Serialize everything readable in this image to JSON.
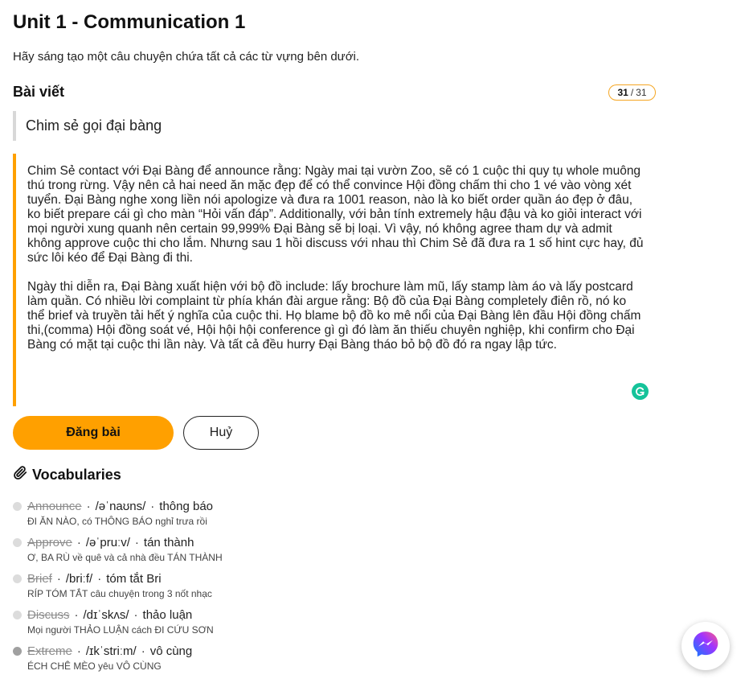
{
  "header": {
    "title": "Unit 1 - Communication 1",
    "instruction": "Hãy sáng tạo một câu chuyện chứa tất cả các từ vựng bên dưới."
  },
  "post": {
    "section_label": "Bài viết",
    "counter_current": "31",
    "counter_sep": "/",
    "counter_total": "31",
    "story_title": "Chim sẻ gọi đại bàng",
    "paragraph_1": "Chim Sẻ contact với Đại Bàng để announce rằng: Ngày mai tại vườn Zoo, sẽ có 1 cuộc thi quy tụ whole muông thú trong rừng. Vậy nên cả hai need ăn mặc đẹp để có thể convince Hội đồng chấm thi cho 1 vé vào vòng xét tuyển. Đại Bàng nghe xong liền nói apologize và đưa ra 1001 reason, nào là ko biết order quần áo đẹp ở đâu, ko biết prepare cái gì cho màn “Hỏi vấn đáp”. Additionally, với bản tính extremely hậu đậu và ko giỏi interact với mọi người xung quanh nên certain 99,999% Đại Bàng sẽ bị loại. Vì vậy, nó không agree tham dự và admit không approve cuộc thi cho lắm. Nhưng sau 1 hồi discuss với nhau thì Chim Sẻ đã đưa ra 1 số hint cực hay, đủ sức lôi kéo để Đại Bàng đi thi.",
    "paragraph_2": "Ngày thi diễn ra, Đại Bàng xuất hiện với bộ đồ include: lấy brochure làm mũ, lấy stamp làm áo và lấy postcard làm quần. Có nhiều lời complaint từ phía khán đài argue rằng: Bộ đồ của Đại Bàng completely điên rồ, nó ko thể brief và truyền tải hết ý nghĩa của cuộc thi. Họ blame bộ đồ ko mê nổi của Đại Bàng lên đầu Hội đồng chấm thi,(comma) Hội đồng soát vé, Hội hội hội conference gì gì đó làm ăn thiếu chuyên nghiệp, khi confirm cho Đại Bàng có mặt tại cuộc thi lần này. Và tất cả đều hurry Đại Bàng tháo bỏ bộ đồ đó ra ngay lập tức.",
    "submit_label": "Đăng bài",
    "cancel_label": "Huỷ"
  },
  "vocab": {
    "heading": "Vocabularies",
    "separator": "·",
    "items": [
      {
        "word": "Announce",
        "ipa": "/əˈnaʊns/",
        "meaning": "thông báo",
        "note": "ĐI ĂN NÀO, có THÔNG BÁO nghỉ trưa rồi"
      },
      {
        "word": "Approve",
        "ipa": "/əˈpruːv/",
        "meaning": "tán thành",
        "note": "Ơ, BA RÙ về quê và cả nhà đều TÁN THÀNH"
      },
      {
        "word": "Brief",
        "ipa": "/briːf/",
        "meaning": "tóm tắt Bri",
        "note": "RÍP TÓM TẮT câu chuyện trong 3 nốt nhạc"
      },
      {
        "word": "Discuss",
        "ipa": "/dɪˈskʌs/",
        "meaning": "thảo luận",
        "note": "Mọi người THẢO LUẬN cách ĐI CỨU SƠN"
      },
      {
        "word": "Extreme",
        "ipa": "/ɪkˈstriːm/",
        "meaning": "vô cùng",
        "note": "ÉCH CHÊ MÈO yêu VÔ CÙNG"
      }
    ]
  },
  "colors": {
    "accent": "#ffa000",
    "grammarly": "#15c39a",
    "messenger_gradient": [
      "#0a7cff",
      "#a033ff",
      "#ff5c87"
    ]
  }
}
